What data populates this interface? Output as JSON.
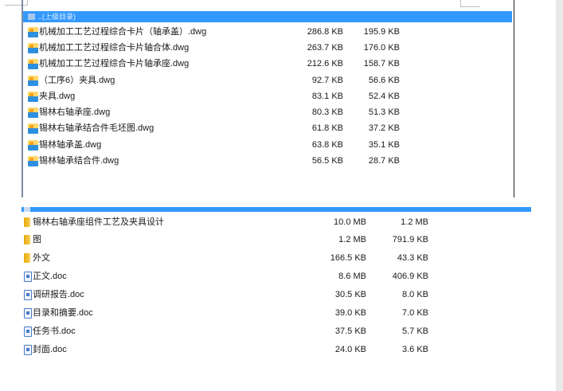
{
  "panel1": {
    "selected_row_label": "..(上级目录)",
    "files": [
      {
        "name": "机械加工工艺过程综合卡片（轴承盖）.dwg",
        "size": "286.8 KB",
        "packed": "195.9 KB"
      },
      {
        "name": "机械加工工艺过程综合卡片轴合体.dwg",
        "size": "263.7 KB",
        "packed": "176.0 KB"
      },
      {
        "name": "机械加工工艺过程综合卡片轴承座.dwg",
        "size": "212.6 KB",
        "packed": "158.7 KB"
      },
      {
        "name": "（工序6）夹具.dwg",
        "size": "92.7 KB",
        "packed": "56.6 KB"
      },
      {
        "name": "夹具.dwg",
        "size": "83.1 KB",
        "packed": "52.4 KB"
      },
      {
        "name": "锡林右轴承座.dwg",
        "size": "80.3 KB",
        "packed": "51.3 KB"
      },
      {
        "name": "锡林右轴承结合件毛坯图.dwg",
        "size": "61.8 KB",
        "packed": "37.2 KB"
      },
      {
        "name": "锡林轴承盖.dwg",
        "size": "63.8 KB",
        "packed": "35.1 KB"
      },
      {
        "name": "锡林轴承结合件.dwg",
        "size": "56.5 KB",
        "packed": "28.7 KB"
      }
    ]
  },
  "panel2": {
    "items": [
      {
        "type": "folder",
        "name": "锡林右轴承座组件工艺及夹具设计",
        "size": "10.0 MB",
        "packed": "1.2 MB"
      },
      {
        "type": "folder",
        "name": "图",
        "size": "1.2 MB",
        "packed": "791.9 KB"
      },
      {
        "type": "folder",
        "name": "外文",
        "size": "166.5 KB",
        "packed": "43.3 KB"
      },
      {
        "type": "doc",
        "name": "正文.doc",
        "size": "8.6 MB",
        "packed": "406.9 KB"
      },
      {
        "type": "doc",
        "name": "调研报告.doc",
        "size": "30.5 KB",
        "packed": "8.0 KB"
      },
      {
        "type": "doc",
        "name": "目录和摘要.doc",
        "size": "39.0 KB",
        "packed": "7.0 KB"
      },
      {
        "type": "doc",
        "name": "任务书.doc",
        "size": "37.5 KB",
        "packed": "5.7 KB"
      },
      {
        "type": "doc",
        "name": "封面.doc",
        "size": "24.0 KB",
        "packed": "3.6 KB"
      }
    ]
  },
  "icons": {
    "dwg": "dwg-file-icon",
    "folder": "folder-icon",
    "doc": "word-document-icon"
  },
  "colors": {
    "selection": "#3399ff",
    "folder": "#f0c040",
    "doc": "#4a7cc9"
  }
}
